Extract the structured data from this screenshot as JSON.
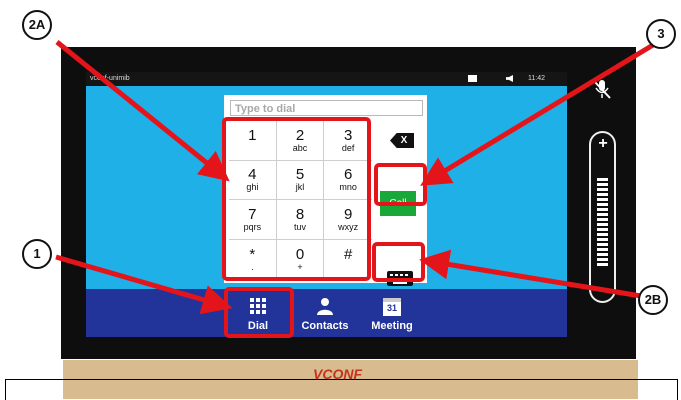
{
  "window": {
    "name": "vconf-unimib",
    "time": "11:42"
  },
  "dial": {
    "placeholder": "Type to dial",
    "backspace_label": "X",
    "call_label": "Call"
  },
  "keypad": [
    {
      "digit": "1",
      "letters": ""
    },
    {
      "digit": "2",
      "letters": "abc"
    },
    {
      "digit": "3",
      "letters": "def"
    },
    {
      "digit": "4",
      "letters": "ghi"
    },
    {
      "digit": "5",
      "letters": "jkl"
    },
    {
      "digit": "6",
      "letters": "mno"
    },
    {
      "digit": "7",
      "letters": "pqrs"
    },
    {
      "digit": "8",
      "letters": "tuv"
    },
    {
      "digit": "9",
      "letters": "wxyz"
    },
    {
      "digit": "*",
      "letters": "."
    },
    {
      "digit": "0",
      "letters": "+"
    },
    {
      "digit": "#",
      "letters": ""
    }
  ],
  "bottom_nav": {
    "dial_label": "Dial",
    "contacts_label": "Contacts",
    "meeting_label": "Meeting",
    "meeting_day": "31"
  },
  "callouts": {
    "c1": "1",
    "c2a": "2A",
    "c2b": "2B",
    "c3": "3"
  },
  "brand": {
    "logo_text": "VCONF"
  },
  "colors": {
    "screen_bg": "#20b0e8",
    "nav_bg": "#22339a",
    "call_green": "#18a83a",
    "annotation_red": "#e3151b"
  }
}
